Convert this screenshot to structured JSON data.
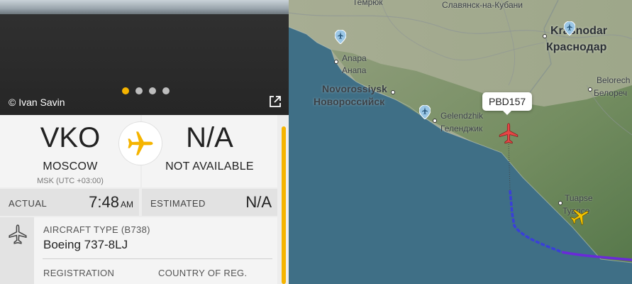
{
  "photo": {
    "credit": "© Ivan Savin",
    "carousel_dots": 4,
    "active_dot": 0
  },
  "route": {
    "origin": {
      "code": "VKO",
      "city": "MOSCOW",
      "timezone": "MSK (UTC +03:00)"
    },
    "destination": {
      "code": "N/A",
      "city": "NOT AVAILABLE"
    }
  },
  "times": {
    "actual_label": "ACTUAL",
    "actual_value": "7:48",
    "actual_ampm": "AM",
    "estimated_label": "ESTIMATED",
    "estimated_value": "N/A"
  },
  "aircraft": {
    "type_label": "AIRCRAFT TYPE",
    "type_code": "(B738)",
    "type_value": "Boeing 737-8LJ",
    "registration_label": "REGISTRATION",
    "country_label": "COUNTRY OF REG."
  },
  "map": {
    "selected_callsign": "PBD157",
    "labels": {
      "temryuk": "Темрюк",
      "slavyansk": "Славянск-на-Кубани",
      "krasnodar_en": "Krasnodar",
      "krasnodar_ru": "Краснодар",
      "anapa_en": "Anapa",
      "anapa_ru": "Анапа",
      "novorossiysk_en": "Novorossiysk",
      "novorossiysk_ru": "Новороссийск",
      "gelendzhik_en": "Gelendzhik",
      "gelendzhik_ru": "Геленджик",
      "belorechensk_en": "Belorech",
      "belorechensk_ru": "Белореч",
      "tuapse_en": "Tuapse",
      "tuapse_ru": "Туапсе"
    }
  },
  "colors": {
    "accent": "#f5b400",
    "sea": "#3f6f86",
    "selected_aircraft": "#e64646",
    "track_blue": "#3a3fd8",
    "track_purple": "#6a2ad8"
  }
}
